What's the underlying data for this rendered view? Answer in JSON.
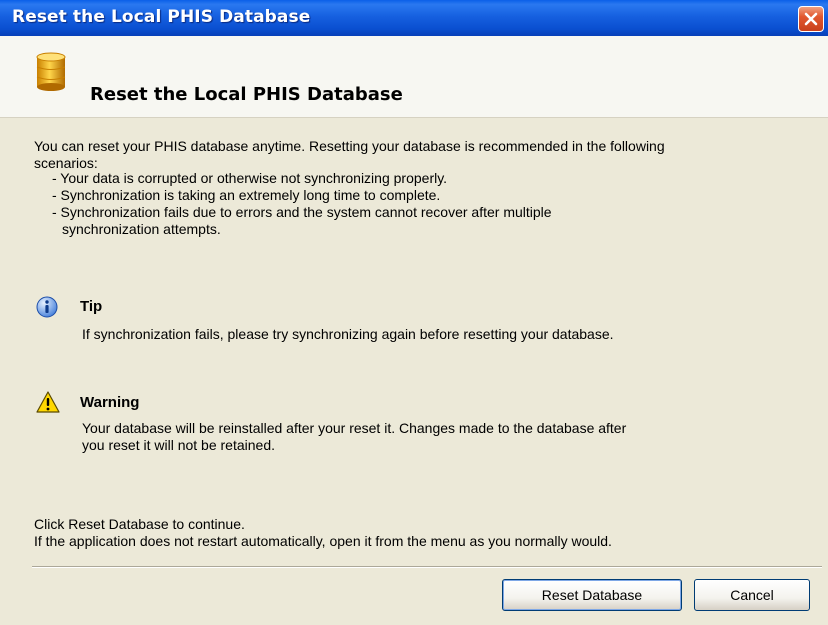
{
  "window": {
    "title": "Reset the Local PHIS Database"
  },
  "header": {
    "title": "Reset the Local PHIS Database",
    "icon": "database-icon"
  },
  "body": {
    "intro": [
      "You can reset your PHIS database anytime. Resetting your database is recommended in the following",
      "scenarios:"
    ],
    "bullets": [
      "- Your data is corrupted or otherwise not synchronizing properly.",
      "- Synchronization is taking an extremely long time to complete.",
      "- Synchronization fails due to errors and the system cannot recover after multiple",
      "synchronization attempts."
    ],
    "tip": {
      "icon": "info-icon",
      "title": "Tip",
      "text": "If synchronization fails, please try synchronizing again before resetting your database."
    },
    "warning": {
      "icon": "warning-icon",
      "title": "Warning",
      "lines": [
        "Your database will be reinstalled after your reset it. Changes made to the database after",
        "you reset it will not be retained."
      ]
    },
    "closing": [
      "Click Reset Database to continue.",
      "If the application does not restart automatically, open it from the menu as you normally would."
    ]
  },
  "buttons": {
    "reset_label": "Reset Database",
    "cancel_label": "Cancel"
  },
  "colors": {
    "titlebar": "#0a4fd0",
    "close": "#e2582f",
    "dialog_bg": "#ece9d8"
  }
}
